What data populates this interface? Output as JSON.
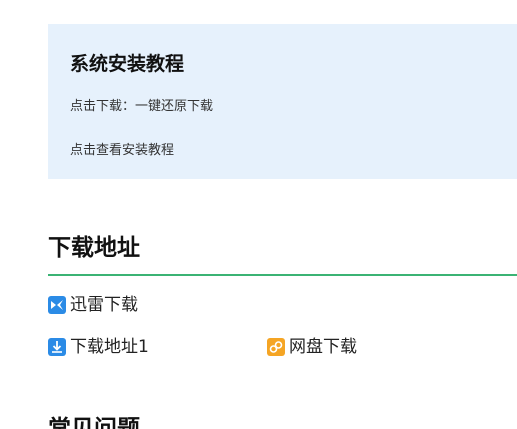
{
  "tutorial": {
    "title": "系统安装教程",
    "download_prefix": "点击下载：",
    "download_link": "一键还原下载",
    "view_tutorial": "点击查看安装教程"
  },
  "downloads": {
    "heading": "下载地址",
    "items": [
      {
        "label": "迅雷下载",
        "icon": "xunlei-icon"
      },
      {
        "label": "下载地址1",
        "icon": "download-arrow-icon"
      },
      {
        "label": "网盘下载",
        "icon": "netdisk-icon"
      }
    ],
    "accent_color": "#3bb374"
  },
  "faq": {
    "heading": "常见问题"
  }
}
